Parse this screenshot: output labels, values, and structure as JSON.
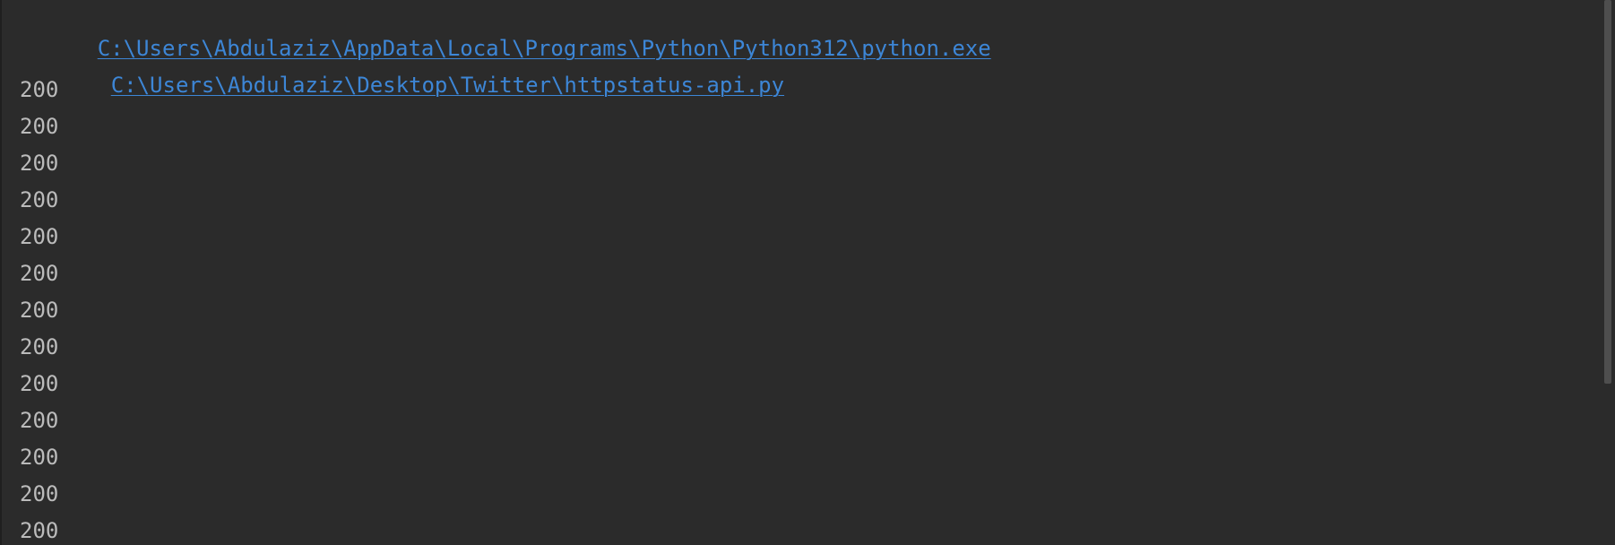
{
  "console": {
    "interpreter_path": "C:\\Users\\Abdulaziz\\AppData\\Local\\Programs\\Python\\Python312\\python.exe",
    "script_path": "C:\\Users\\Abdulaziz\\Desktop\\Twitter\\httpstatus-api.py",
    "output_lines": [
      "200",
      "200",
      "200",
      "200",
      "200",
      "200",
      "200",
      "200",
      "200",
      "200",
      "200",
      "200",
      "200"
    ],
    "colors": {
      "background": "#2b2b2b",
      "text": "#bbbbbb",
      "link": "#3d86d6"
    }
  }
}
